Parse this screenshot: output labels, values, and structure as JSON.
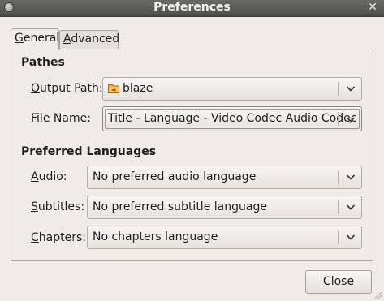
{
  "window": {
    "title": "Preferences"
  },
  "tabs": [
    {
      "label": "General",
      "mnemonic": "G",
      "rest": "eneral"
    },
    {
      "label": "Advanced",
      "mnemonic": "A",
      "rest": "dvanced"
    }
  ],
  "sections": {
    "pathes": "Pathes",
    "languages": "Preferred Languages"
  },
  "fields": {
    "output_path": {
      "mnemonic": "O",
      "rest": "utput Path:",
      "value": "blaze",
      "icon": "folder-icon"
    },
    "file_name": {
      "mnemonic": "F",
      "rest": "ile Name:",
      "value": "Title - Language - Video Codec Audio Codec"
    },
    "audio": {
      "mnemonic": "A",
      "rest": "udio:",
      "value": "No preferred audio language"
    },
    "subtitles": {
      "mnemonic": "S",
      "rest": "ubtitles:",
      "value": "No preferred subtitle language"
    },
    "chapters": {
      "mnemonic": "C",
      "rest": "hapters:",
      "value": "No chapters language"
    }
  },
  "buttons": {
    "close": {
      "mnemonic": "C",
      "rest": "lose"
    }
  }
}
